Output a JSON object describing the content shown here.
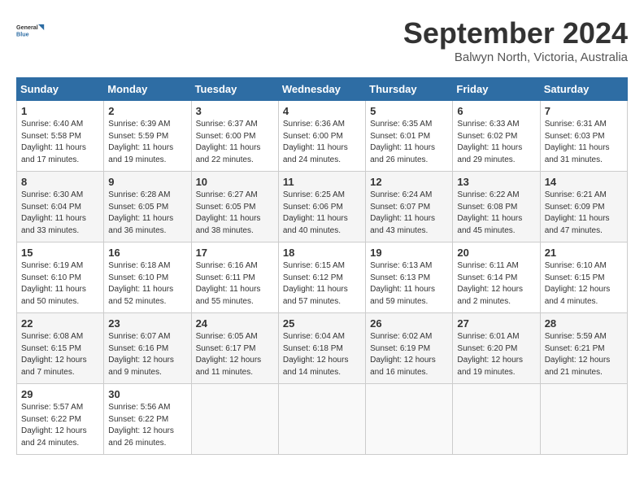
{
  "header": {
    "logo_line1": "General",
    "logo_line2": "Blue",
    "month_title": "September 2024",
    "subtitle": "Balwyn North, Victoria, Australia"
  },
  "weekdays": [
    "Sunday",
    "Monday",
    "Tuesday",
    "Wednesday",
    "Thursday",
    "Friday",
    "Saturday"
  ],
  "weeks": [
    [
      {
        "day": "1",
        "sunrise": "6:40 AM",
        "sunset": "5:58 PM",
        "daylight": "11 hours and 17 minutes."
      },
      {
        "day": "2",
        "sunrise": "6:39 AM",
        "sunset": "5:59 PM",
        "daylight": "11 hours and 19 minutes."
      },
      {
        "day": "3",
        "sunrise": "6:37 AM",
        "sunset": "6:00 PM",
        "daylight": "11 hours and 22 minutes."
      },
      {
        "day": "4",
        "sunrise": "6:36 AM",
        "sunset": "6:00 PM",
        "daylight": "11 hours and 24 minutes."
      },
      {
        "day": "5",
        "sunrise": "6:35 AM",
        "sunset": "6:01 PM",
        "daylight": "11 hours and 26 minutes."
      },
      {
        "day": "6",
        "sunrise": "6:33 AM",
        "sunset": "6:02 PM",
        "daylight": "11 hours and 29 minutes."
      },
      {
        "day": "7",
        "sunrise": "6:31 AM",
        "sunset": "6:03 PM",
        "daylight": "11 hours and 31 minutes."
      }
    ],
    [
      {
        "day": "8",
        "sunrise": "6:30 AM",
        "sunset": "6:04 PM",
        "daylight": "11 hours and 33 minutes."
      },
      {
        "day": "9",
        "sunrise": "6:28 AM",
        "sunset": "6:05 PM",
        "daylight": "11 hours and 36 minutes."
      },
      {
        "day": "10",
        "sunrise": "6:27 AM",
        "sunset": "6:05 PM",
        "daylight": "11 hours and 38 minutes."
      },
      {
        "day": "11",
        "sunrise": "6:25 AM",
        "sunset": "6:06 PM",
        "daylight": "11 hours and 40 minutes."
      },
      {
        "day": "12",
        "sunrise": "6:24 AM",
        "sunset": "6:07 PM",
        "daylight": "11 hours and 43 minutes."
      },
      {
        "day": "13",
        "sunrise": "6:22 AM",
        "sunset": "6:08 PM",
        "daylight": "11 hours and 45 minutes."
      },
      {
        "day": "14",
        "sunrise": "6:21 AM",
        "sunset": "6:09 PM",
        "daylight": "11 hours and 47 minutes."
      }
    ],
    [
      {
        "day": "15",
        "sunrise": "6:19 AM",
        "sunset": "6:10 PM",
        "daylight": "11 hours and 50 minutes."
      },
      {
        "day": "16",
        "sunrise": "6:18 AM",
        "sunset": "6:10 PM",
        "daylight": "11 hours and 52 minutes."
      },
      {
        "day": "17",
        "sunrise": "6:16 AM",
        "sunset": "6:11 PM",
        "daylight": "11 hours and 55 minutes."
      },
      {
        "day": "18",
        "sunrise": "6:15 AM",
        "sunset": "6:12 PM",
        "daylight": "11 hours and 57 minutes."
      },
      {
        "day": "19",
        "sunrise": "6:13 AM",
        "sunset": "6:13 PM",
        "daylight": "11 hours and 59 minutes."
      },
      {
        "day": "20",
        "sunrise": "6:11 AM",
        "sunset": "6:14 PM",
        "daylight": "12 hours and 2 minutes."
      },
      {
        "day": "21",
        "sunrise": "6:10 AM",
        "sunset": "6:15 PM",
        "daylight": "12 hours and 4 minutes."
      }
    ],
    [
      {
        "day": "22",
        "sunrise": "6:08 AM",
        "sunset": "6:15 PM",
        "daylight": "12 hours and 7 minutes."
      },
      {
        "day": "23",
        "sunrise": "6:07 AM",
        "sunset": "6:16 PM",
        "daylight": "12 hours and 9 minutes."
      },
      {
        "day": "24",
        "sunrise": "6:05 AM",
        "sunset": "6:17 PM",
        "daylight": "12 hours and 11 minutes."
      },
      {
        "day": "25",
        "sunrise": "6:04 AM",
        "sunset": "6:18 PM",
        "daylight": "12 hours and 14 minutes."
      },
      {
        "day": "26",
        "sunrise": "6:02 AM",
        "sunset": "6:19 PM",
        "daylight": "12 hours and 16 minutes."
      },
      {
        "day": "27",
        "sunrise": "6:01 AM",
        "sunset": "6:20 PM",
        "daylight": "12 hours and 19 minutes."
      },
      {
        "day": "28",
        "sunrise": "5:59 AM",
        "sunset": "6:21 PM",
        "daylight": "12 hours and 21 minutes."
      }
    ],
    [
      {
        "day": "29",
        "sunrise": "5:57 AM",
        "sunset": "6:22 PM",
        "daylight": "12 hours and 24 minutes."
      },
      {
        "day": "30",
        "sunrise": "5:56 AM",
        "sunset": "6:22 PM",
        "daylight": "12 hours and 26 minutes."
      },
      null,
      null,
      null,
      null,
      null
    ]
  ]
}
